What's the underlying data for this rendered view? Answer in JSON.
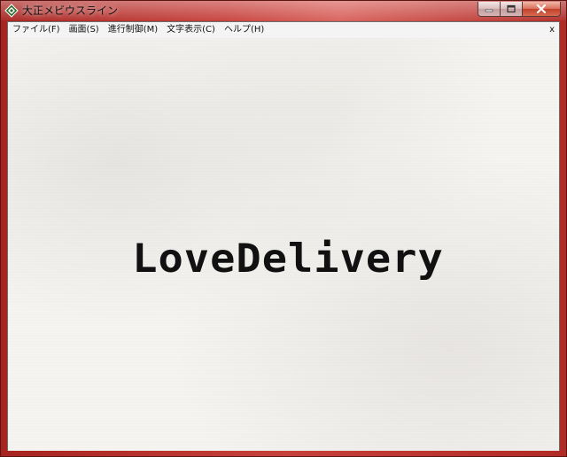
{
  "window": {
    "title": "大正メビウスライン",
    "icon": "diamond-app-icon",
    "controls": [
      "minimize-icon",
      "maximize-icon",
      "close-icon"
    ]
  },
  "menubar": {
    "items": [
      {
        "label": "ファイル(F)"
      },
      {
        "label": "画面(S)"
      },
      {
        "label": "進行制御(M)"
      },
      {
        "label": "文字表示(C)"
      },
      {
        "label": "ヘルプ(H)"
      }
    ],
    "close_label": "x"
  },
  "stage": {
    "logo_text": "LoveDelivery"
  },
  "colors": {
    "frame_accent": "#b8342f",
    "stage_background": "#f5f4f1",
    "logo_color": "#111111"
  }
}
